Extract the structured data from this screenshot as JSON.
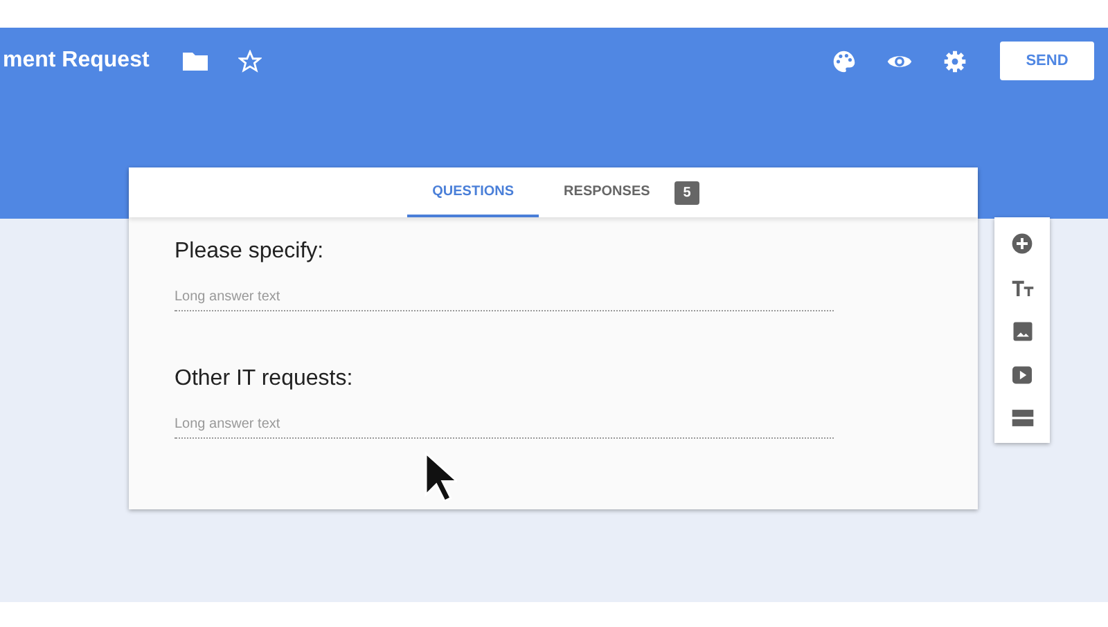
{
  "header": {
    "title": "ment Request",
    "send_label": "SEND"
  },
  "tabs": [
    {
      "label": "QUESTIONS",
      "selected": true
    },
    {
      "label": "RESPONSES",
      "selected": false,
      "count": "5"
    }
  ],
  "questions": [
    {
      "title": "Please specify:",
      "placeholder": "Long answer text"
    },
    {
      "title": "Other IT requests:",
      "placeholder": "Long answer text"
    }
  ]
}
